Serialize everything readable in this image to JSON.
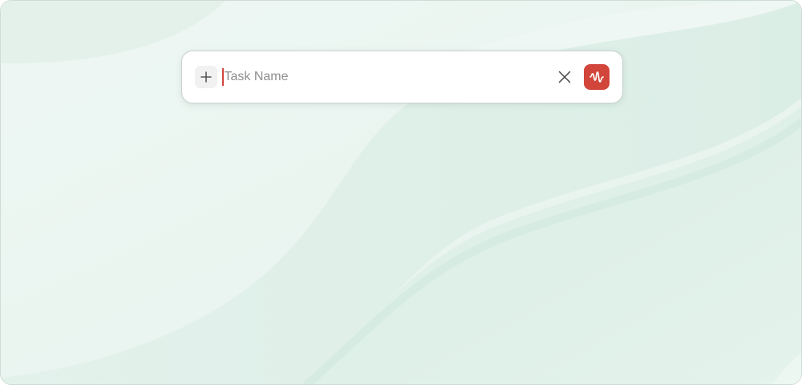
{
  "quick_add": {
    "placeholder": "Task Name",
    "value": "",
    "add_icon": "plus-icon",
    "clear_icon": "close-icon",
    "voice_icon": "waveform-icon"
  },
  "colors": {
    "accent": "#d1453b",
    "background": "#e9f4ef",
    "wave_dark": "#d3ebe2"
  }
}
